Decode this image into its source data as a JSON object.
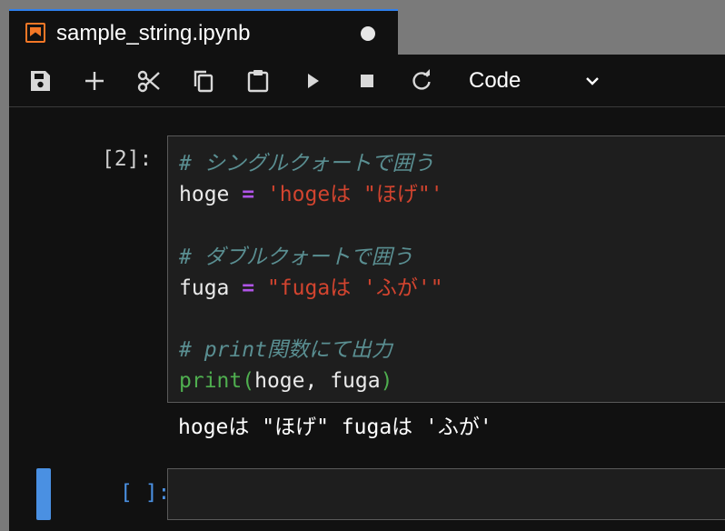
{
  "tab": {
    "title": "sample_string.ipynb",
    "icon": "notebook-icon",
    "unsaved_indicator": "unsaved-dot-icon"
  },
  "toolbar": {
    "buttons": [
      "save-icon",
      "add-icon",
      "cut-icon",
      "copy-icon",
      "paste-icon",
      "run-icon",
      "stop-icon",
      "restart-icon"
    ],
    "cell_type": "Code"
  },
  "cells": [
    {
      "prompt": "[2]:",
      "lines": [
        [
          {
            "t": "# シングルクォートで囲う",
            "k": "comment"
          }
        ],
        [
          {
            "t": "hoge ",
            "k": "plain"
          },
          {
            "t": "=",
            "k": "op"
          },
          {
            "t": " 'hogeは \"ほげ\"'",
            "k": "str"
          }
        ],
        [],
        [
          {
            "t": "# ダブルクォートで囲う",
            "k": "comment"
          }
        ],
        [
          {
            "t": "fuga ",
            "k": "plain"
          },
          {
            "t": "=",
            "k": "op"
          },
          {
            "t": " \"fugaは 'ふが'\"",
            "k": "str"
          }
        ],
        [],
        [
          {
            "t": "# print関数にて出力",
            "k": "comment"
          }
        ],
        [
          {
            "t": "print",
            "k": "builtin"
          },
          {
            "t": "(",
            "k": "paren"
          },
          {
            "t": "hoge, fuga",
            "k": "plain"
          },
          {
            "t": ")",
            "k": "paren"
          }
        ]
      ],
      "output": "hogeは \"ほげ\" fugaは 'ふが'"
    },
    {
      "prompt": "[ ]:",
      "lines": []
    }
  ],
  "colors": {
    "accent": "#2f80ed",
    "active_cell": "#4a90e2",
    "comment": "#5a8f92",
    "string": "#d2442f",
    "operator": "#b054e8",
    "builtin": "#4fae4f",
    "notebook_icon": "#f37726"
  }
}
